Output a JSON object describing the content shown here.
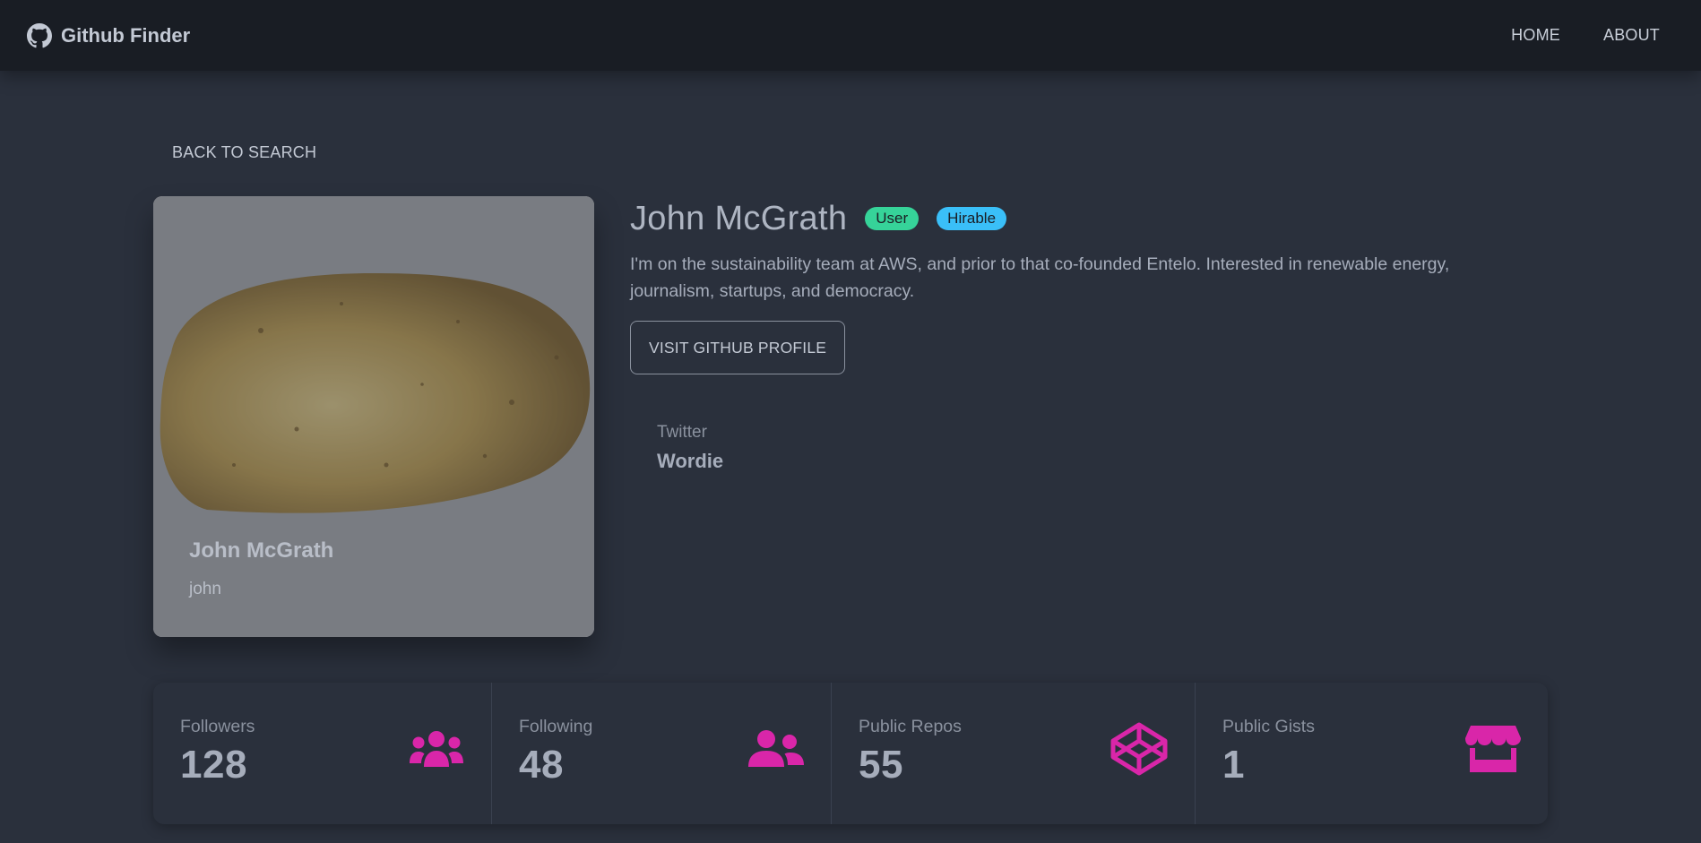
{
  "app": {
    "title": "Github Finder",
    "accent_color": "#d926a9",
    "brand_icon": "github-icon"
  },
  "nav": {
    "links": [
      {
        "label": "HOME"
      },
      {
        "label": "ABOUT"
      }
    ]
  },
  "actions": {
    "back_label": "BACK TO SEARCH",
    "visit_label": "VISIT GITHUB PROFILE"
  },
  "user": {
    "name": "John McGrath",
    "login": "john",
    "type_badge": "User",
    "hirable_badge": "Hirable",
    "bio": "I'm on the sustainability team at AWS, and prior to that co-founded Entelo. Interested in renewable energy, journalism, startups, and democracy.",
    "avatar_icon": "potato-avatar"
  },
  "social": {
    "label": "Twitter",
    "value": "Wordie"
  },
  "stats": [
    {
      "label": "Followers",
      "value": "128",
      "icon": "users-icon"
    },
    {
      "label": "Following",
      "value": "48",
      "icon": "user-friends-icon"
    },
    {
      "label": "Public Repos",
      "value": "55",
      "icon": "codepen-icon"
    },
    {
      "label": "Public Gists",
      "value": "1",
      "icon": "store-icon"
    }
  ]
}
